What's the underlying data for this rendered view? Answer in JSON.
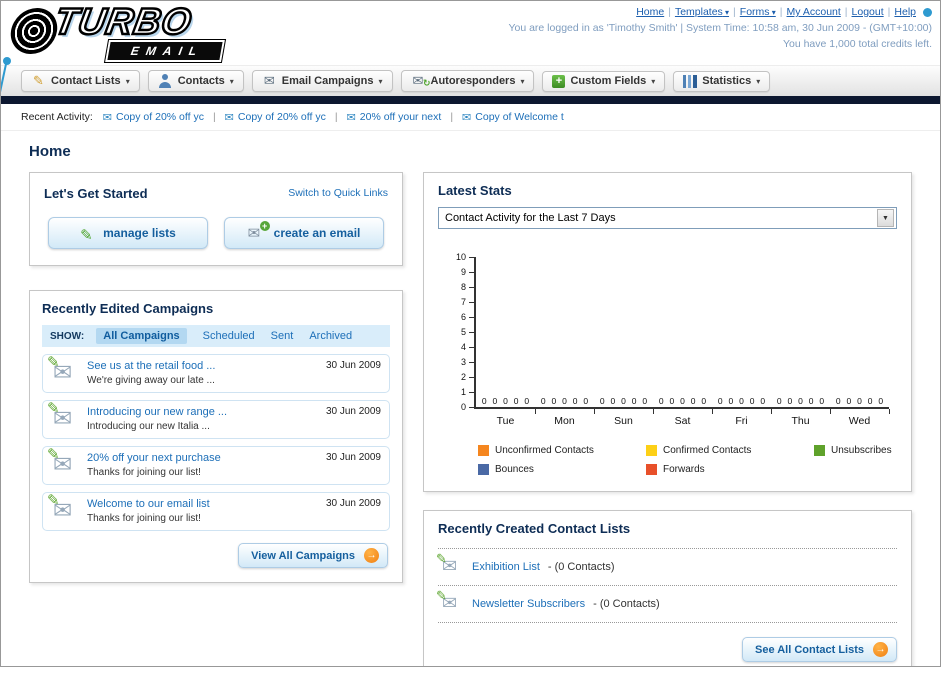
{
  "header": {
    "logo_primary": "TURBO",
    "logo_secondary": "EMAIL",
    "nav": [
      {
        "label": "Home",
        "dropdown": false
      },
      {
        "label": "Templates",
        "dropdown": true
      },
      {
        "label": "Forms",
        "dropdown": true
      },
      {
        "label": "My Account",
        "dropdown": false
      },
      {
        "label": "Logout",
        "dropdown": false
      },
      {
        "label": "Help",
        "dropdown": false
      }
    ],
    "session_line": "You are logged in as 'Timothy Smith' | System Time: 10:58 am, 30 Jun 2009 - (GMT+10:00)",
    "credits_line": "You have 1,000 total credits left."
  },
  "main_nav": {
    "tabs": [
      {
        "label": "Contact Lists",
        "icon": "contact-lists-icon"
      },
      {
        "label": "Contacts",
        "icon": "contacts-icon"
      },
      {
        "label": "Email Campaigns",
        "icon": "email-campaigns-icon"
      },
      {
        "label": "Autoresponders",
        "icon": "autoresponders-icon"
      },
      {
        "label": "Custom Fields",
        "icon": "custom-fields-icon"
      },
      {
        "label": "Statistics",
        "icon": "statistics-icon"
      }
    ]
  },
  "recent_activity": {
    "label": "Recent Activity:",
    "items": [
      "Copy of 20% off yc",
      "Copy of 20% off yc",
      "20% off your next",
      "Copy of Welcome t"
    ]
  },
  "page": {
    "title": "Home"
  },
  "get_started": {
    "title": "Let's Get Started",
    "switch_link": "Switch to Quick Links",
    "manage_lists_label": "manage lists",
    "create_email_label": "create an email"
  },
  "campaigns": {
    "title": "Recently Edited Campaigns",
    "show_label": "SHOW:",
    "filters": [
      "All Campaigns",
      "Scheduled",
      "Sent",
      "Archived"
    ],
    "active_filter": "All Campaigns",
    "items": [
      {
        "title": "See us at the retail food ...",
        "subtitle": "We're giving away our late ...",
        "date": "30 Jun 2009"
      },
      {
        "title": "Introducing our new range ...",
        "subtitle": "Introducing our new Italia ...",
        "date": "30 Jun 2009"
      },
      {
        "title": "20% off your next purchase",
        "subtitle": "Thanks for joining our list!",
        "date": "30 Jun 2009"
      },
      {
        "title": "Welcome to our email list",
        "subtitle": "Thanks for joining our list!",
        "date": "30 Jun 2009"
      }
    ],
    "view_all_label": "View All Campaigns"
  },
  "stats": {
    "title": "Latest Stats",
    "activity_dropdown": "Contact Activity for the Last 7 Days",
    "chart_data": {
      "type": "bar",
      "title": "Contact Activity for the Last 7 Days",
      "categories": [
        "Tue",
        "Mon",
        "Sun",
        "Sat",
        "Fri",
        "Thu",
        "Wed"
      ],
      "series": [
        {
          "name": "Unconfirmed Contacts",
          "color": "#f5861f",
          "values": [
            0,
            0,
            0,
            0,
            0,
            0,
            0
          ]
        },
        {
          "name": "Confirmed Contacts",
          "color": "#fdd017",
          "values": [
            0,
            0,
            0,
            0,
            0,
            0,
            0
          ]
        },
        {
          "name": "Unsubscribes",
          "color": "#5fa22b",
          "values": [
            0,
            0,
            0,
            0,
            0,
            0,
            0
          ]
        },
        {
          "name": "Bounces",
          "color": "#4a69a5",
          "values": [
            0,
            0,
            0,
            0,
            0,
            0,
            0
          ]
        },
        {
          "name": "Forwards",
          "color": "#e8502a",
          "values": [
            0,
            0,
            0,
            0,
            0,
            0,
            0
          ]
        }
      ],
      "ylim": [
        0,
        10
      ],
      "ytick_step": 1,
      "grid": false,
      "legend_position": "bottom",
      "value_labels_shown": true
    }
  },
  "contact_lists": {
    "title": "Recently Created Contact Lists",
    "items": [
      {
        "name": "Exhibition List",
        "detail": "- (0 Contacts)"
      },
      {
        "name": "Newsletter Subscribers",
        "detail": "- (0 Contacts)"
      }
    ],
    "see_all_label": "See All Contact Lists"
  }
}
